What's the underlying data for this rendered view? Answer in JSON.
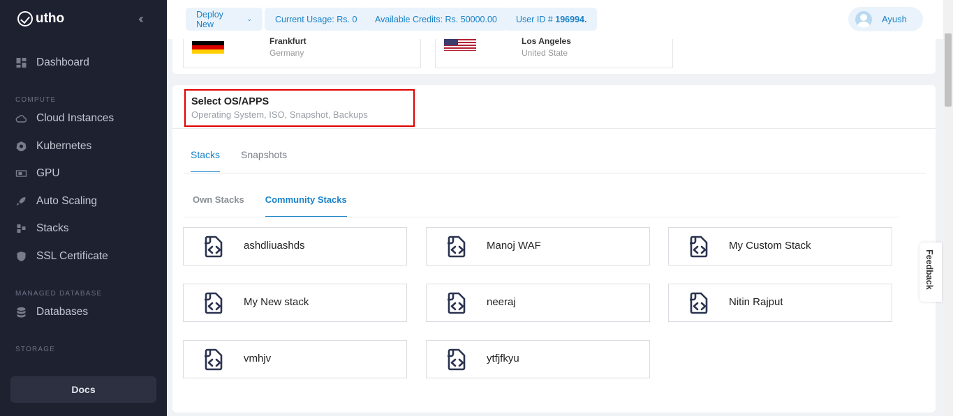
{
  "sidebar": {
    "logo_text": "utho",
    "collapse_icon": "double-chevron-left-icon",
    "items": [
      {
        "label": "Dashboard",
        "icon": "dashboard-icon"
      },
      {
        "label": "Cloud Instances",
        "icon": "cloud-icon"
      },
      {
        "label": "Kubernetes",
        "icon": "kubernetes-icon"
      },
      {
        "label": "GPU",
        "icon": "gpu-icon"
      },
      {
        "label": "Auto Scaling",
        "icon": "rocket-icon"
      },
      {
        "label": "Stacks",
        "icon": "stacks-icon"
      },
      {
        "label": "SSL Certificate",
        "icon": "shield-icon"
      },
      {
        "label": "Databases",
        "icon": "database-icon"
      }
    ],
    "sections": [
      "COMPUTE",
      "MANAGED DATABASE",
      "STORAGE"
    ],
    "docs_label": "Docs"
  },
  "topbar": {
    "deploy_label": "Deploy New",
    "usage_label": "Current Usage: Rs. 0",
    "credits_label": "Available Credits: Rs. 50000.00",
    "userid_prefix": "User ID # ",
    "userid_value": "196994.",
    "user_name": "Ayush"
  },
  "locations": [
    {
      "city": "Frankfurt",
      "country": "Germany"
    },
    {
      "city": "Los Angeles",
      "country": "United State"
    }
  ],
  "os_section": {
    "title": "Select OS/APPS",
    "subtitle": "Operating System, ISO, Snapshot, Backups"
  },
  "tabs": [
    "Stacks",
    "Snapshots"
  ],
  "subtabs": [
    "Own Stacks",
    "Community Stacks"
  ],
  "stacks": [
    "ashdliuashds",
    "Manoj WAF",
    "My Custom Stack",
    "My New stack",
    "neeraj",
    "Nitin Rajput",
    "vmhjv",
    "ytfjfkyu"
  ],
  "feedback_label": "Feedback",
  "colors": {
    "accent": "#1a82c8",
    "sidebar_bg": "#1e2130",
    "highlight_border": "#e00000"
  }
}
